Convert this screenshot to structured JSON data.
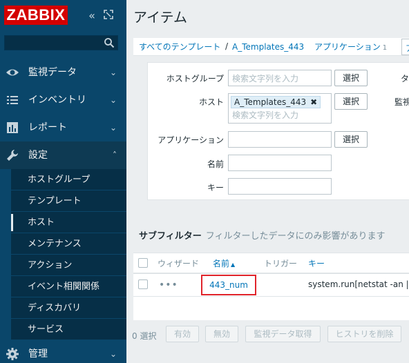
{
  "sidebar": {
    "logo": "ZABBIX",
    "search_placeholder": "",
    "menu": [
      {
        "label": "監視データ",
        "icon": "eye-icon"
      },
      {
        "label": "インベントリ",
        "icon": "list-icon"
      },
      {
        "label": "レポート",
        "icon": "bar-chart-icon"
      },
      {
        "label": "設定",
        "icon": "wrench-icon"
      },
      {
        "label": "管理",
        "icon": "gear-icon"
      }
    ],
    "submenu": [
      {
        "label": "ホストグループ"
      },
      {
        "label": "テンプレート"
      },
      {
        "label": "ホスト",
        "selected": true
      },
      {
        "label": "メンテナンス"
      },
      {
        "label": "アクション"
      },
      {
        "label": "イベント相関関係"
      },
      {
        "label": "ディスカバリ"
      },
      {
        "label": "サービス"
      }
    ],
    "colors": {
      "background": "#0a466a",
      "logo": "#d40000"
    }
  },
  "page": {
    "title": "アイテム"
  },
  "breadcrumbs": {
    "all_templates": "すべてのテンプレート",
    "separator": "/",
    "template": "A_Templates_443",
    "applications": "アプリケーション",
    "applications_count": "1",
    "cut": "ア"
  },
  "filter": {
    "host_group_label": "ホストグループ",
    "host_label": "ホスト",
    "application_label": "アプリケーション",
    "name_label": "名前",
    "key_label": "キー",
    "search_placeholder": "検索文字列を入力",
    "host_tag": "A_Templates_443",
    "select_button": "選択",
    "cut_type": "タ",
    "cut_monitor": "監視"
  },
  "subfilter": {
    "title": "サブフィルター",
    "hint": "フィルターしたデータにのみ影響があります"
  },
  "table": {
    "headers": {
      "wizard": "ウィザード",
      "name": "名前",
      "triggers": "トリガー",
      "key": "キー"
    },
    "rows": [
      {
        "name": "443_num",
        "key": "system.run[netstat -an |gre"
      }
    ]
  },
  "actions": {
    "selected": "0 選択",
    "enable": "有効",
    "disable": "無効",
    "check_now": "監視データ取得",
    "clear_history": "ヒストリを削除"
  },
  "colors": {
    "link": "#0275b8",
    "highlight_box": "#e0242b"
  }
}
